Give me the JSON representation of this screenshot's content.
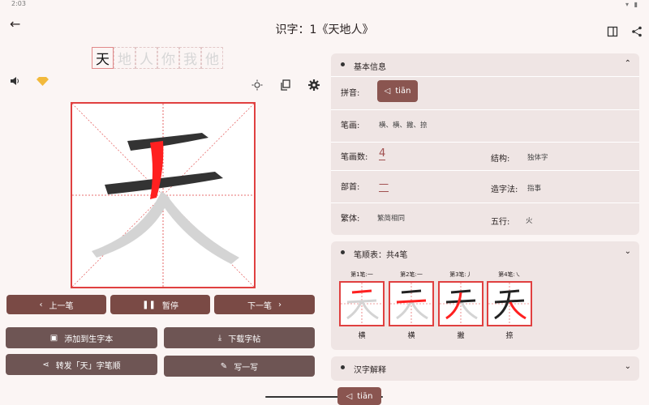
{
  "status": {
    "time": "2:03",
    "icons": "▾ ▮"
  },
  "appbar": {
    "back": "←",
    "title": "识字：1《天地人》"
  },
  "chars": [
    "天",
    "地",
    "人",
    "你",
    "我",
    "他"
  ],
  "controls": {
    "sound_icon": "speaker-icon",
    "gem_icon": "diamond-icon"
  },
  "buttons": {
    "prev": "上一笔",
    "pause": "暂停",
    "next": "下一笔",
    "add_new": "添加到生字本",
    "download": "下载字帖",
    "share": "转发「天」字笔顺",
    "write": "写一写"
  },
  "info": {
    "header": "基本信息",
    "pinyin_label": "拼音:",
    "pinyin": "tiān",
    "strokes_label": "笔画:",
    "strokes": "横、横、撇、捺",
    "count_label": "笔画数:",
    "count": "4",
    "structure_label": "结构:",
    "structure": "独体字",
    "radical_label": "部首:",
    "radical": "一",
    "formation_label": "造字法:",
    "formation": "指事",
    "traditional_label": "繁体:",
    "traditional": "繁简相同",
    "element_label": "五行:",
    "element": "火"
  },
  "order": {
    "header": "笔顺表：共4笔",
    "items": [
      {
        "cap": "第1笔:一",
        "name": "横"
      },
      {
        "cap": "第2笔:一",
        "name": "横"
      },
      {
        "cap": "第3笔:丿",
        "name": "撇"
      },
      {
        "cap": "第4笔:㇏",
        "name": "捺"
      }
    ]
  },
  "explain": {
    "header": "汉字解释"
  },
  "bottom_pinyin": "tiān",
  "colors": {
    "accent": "#8a5550",
    "red": "#e04040",
    "bg": "#fbf5f4"
  }
}
